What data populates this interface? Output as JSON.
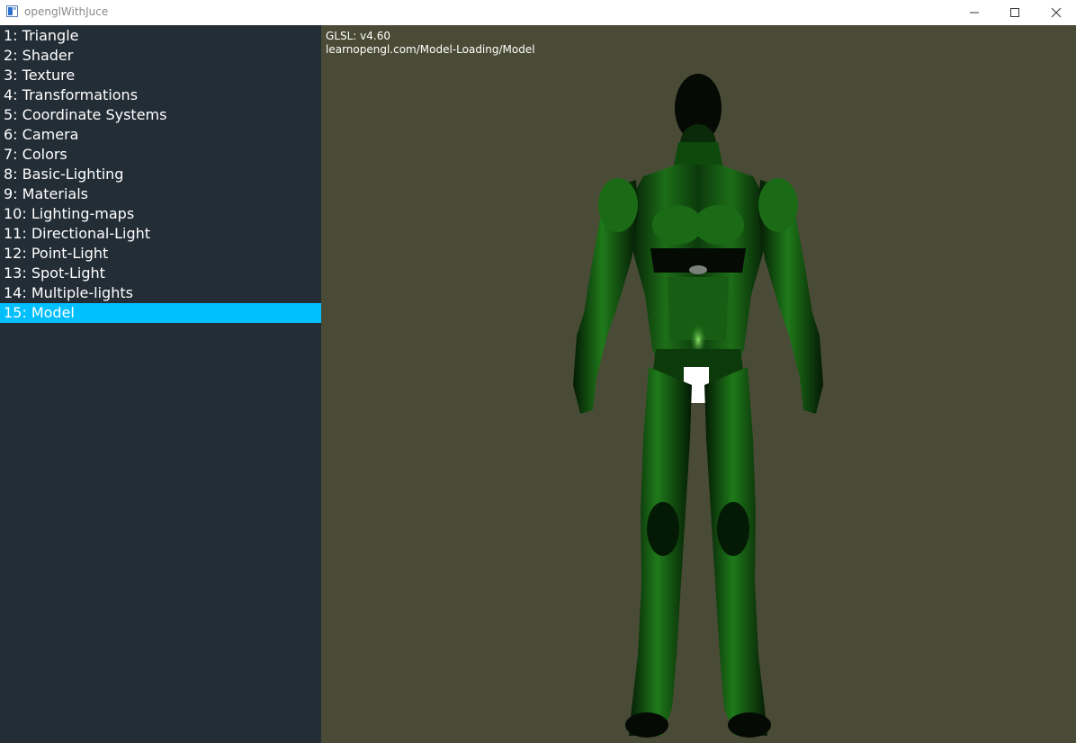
{
  "window": {
    "title": "openglWithJuce"
  },
  "sidebar": {
    "items": [
      {
        "label": "1: Triangle"
      },
      {
        "label": "2: Shader"
      },
      {
        "label": "3: Texture"
      },
      {
        "label": "4: Transformations"
      },
      {
        "label": "5: Coordinate Systems"
      },
      {
        "label": "6: Camera"
      },
      {
        "label": "7: Colors"
      },
      {
        "label": "8: Basic-Lighting"
      },
      {
        "label": "9: Materials"
      },
      {
        "label": "10: Lighting-maps"
      },
      {
        "label": "11: Directional-Light"
      },
      {
        "label": "12: Point-Light"
      },
      {
        "label": "13: Spot-Light"
      },
      {
        "label": "14: Multiple-lights"
      },
      {
        "label": "15: Model"
      }
    ],
    "selected_index": 14
  },
  "viewport": {
    "glsl_version": "GLSL: v4.60",
    "source_url": "learnopengl.com/Model-Loading/Model"
  },
  "colors": {
    "sidebar_bg": "#232d36",
    "selected_bg": "#00bfff",
    "viewport_bg": "#4a4b36",
    "model_green": "#1f7a1a"
  },
  "icons": {
    "app": "app-window-icon",
    "minimize": "minimize-icon",
    "maximize": "maximize-icon",
    "close": "close-icon"
  }
}
